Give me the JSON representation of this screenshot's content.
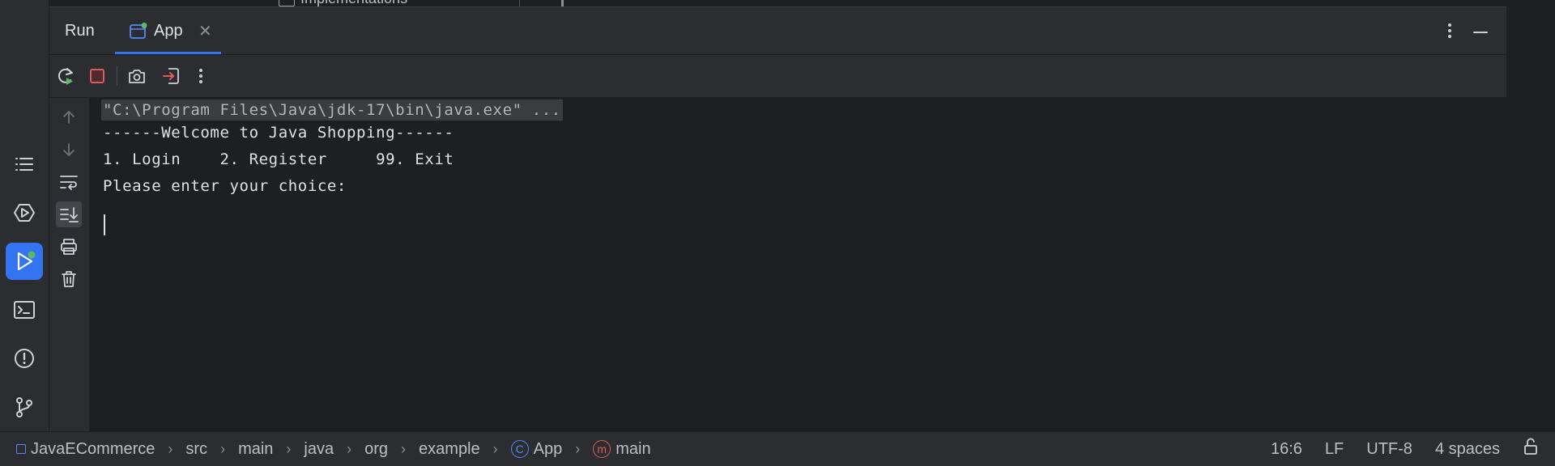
{
  "editor_sliver": {
    "text": "Implementations"
  },
  "run_panel": {
    "title": "Run",
    "tab": {
      "label": "App",
      "close": "✕"
    }
  },
  "console": {
    "lines": [
      "\"C:\\Program Files\\Java\\jdk-17\\bin\\java.exe\" ...",
      "------Welcome to Java Shopping------",
      "1. Login    2. Register     99. Exit",
      "Please enter your choice:"
    ]
  },
  "status_bar": {
    "breadcrumbs": [
      "JavaECommerce",
      "src",
      "main",
      "java",
      "org",
      "example",
      "App",
      "main"
    ],
    "position": "16:6",
    "line_ending": "LF",
    "encoding": "UTF-8",
    "indent": "4 spaces"
  },
  "colors": {
    "accent": "#3574f0",
    "stop": "#db5c5c",
    "rerun_green": "#5fb865",
    "class_icon": "#548af7",
    "method_icon": "#db5c5c"
  },
  "icons": {
    "left_strip": [
      "structure-icon",
      "services-icon",
      "run-icon",
      "terminal-icon",
      "problems-icon",
      "git-icon"
    ],
    "toolbar": [
      "rerun-icon",
      "stop-icon",
      "screenshot-icon",
      "exit-icon",
      "more-icon"
    ],
    "console_side": [
      "up-arrow-icon",
      "down-arrow-icon",
      "soft-wrap-icon",
      "scroll-to-end-icon",
      "print-icon",
      "trash-icon"
    ]
  }
}
